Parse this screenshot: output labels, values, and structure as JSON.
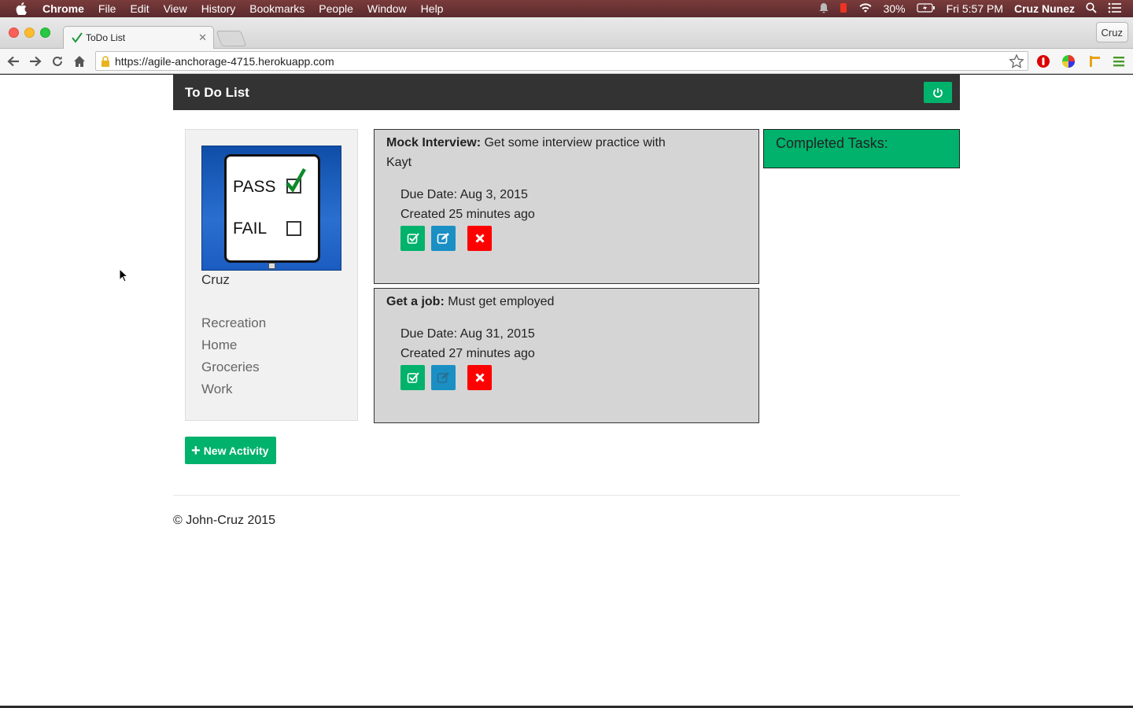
{
  "menubar": {
    "app": "Chrome",
    "items": [
      "File",
      "Edit",
      "View",
      "History",
      "Bookmarks",
      "People",
      "Window",
      "Help"
    ],
    "battery": "30%",
    "clock": "Fri 5:57 PM",
    "user": "Cruz Nunez"
  },
  "browser": {
    "tab_title": "ToDo List",
    "profile": "Cruz",
    "url": "https://agile-anchorage-4715.herokuapp.com"
  },
  "app": {
    "brand": "To Do List",
    "user_name": "Cruz",
    "avatar_labels": {
      "pass": "PASS",
      "fail": "FAIL"
    },
    "categories": [
      "Recreation",
      "Home",
      "Groceries",
      "Work"
    ],
    "new_activity_label": "New Activity",
    "completed_label": "Completed Tasks:",
    "tasks": [
      {
        "name": "Mock Interview:",
        "description": "Get some interview practice with Kayt",
        "due": "Due Date: Aug 3, 2015",
        "created": "Created 25 minutes ago"
      },
      {
        "name": "Get a job:",
        "description": "Must get employed",
        "due": "Due Date: Aug 31, 2015",
        "created": "Created 27 minutes ago"
      }
    ],
    "footer": "© John-Cruz 2015"
  },
  "colors": {
    "accent_green": "#00b26b",
    "edit_blue": "#1a8fc4",
    "delete_red": "#ff0000",
    "navbar_dark": "#333333",
    "task_gray": "#d5d5d5"
  }
}
